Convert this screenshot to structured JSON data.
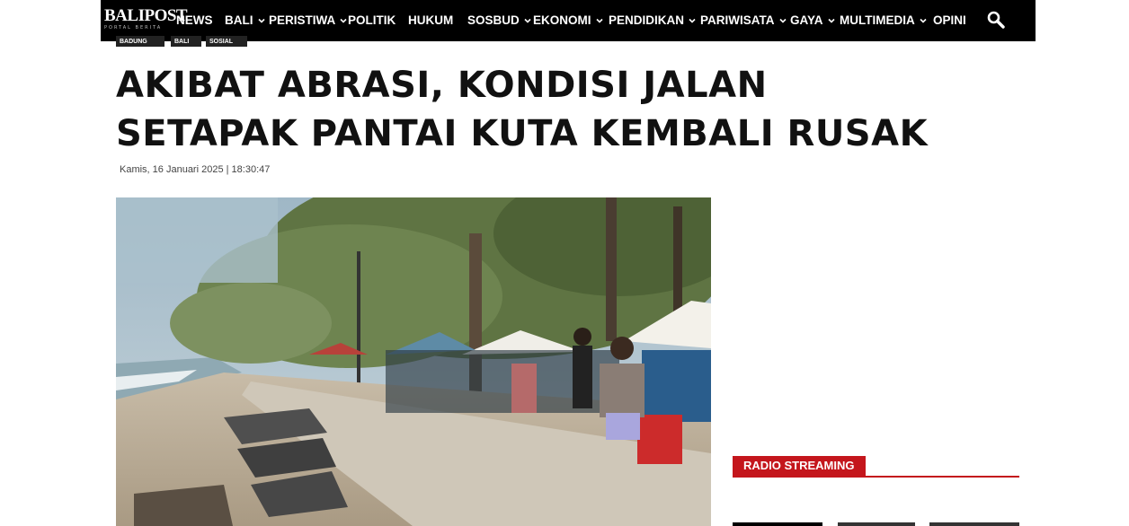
{
  "nav": {
    "logo_text": "BALIPOST",
    "logo_subtext": "PORTAL BERITA",
    "items": [
      {
        "label": "NEWS"
      },
      {
        "label": "BALI"
      },
      {
        "label": "PERISTIWA"
      },
      {
        "label": "POLITIK"
      },
      {
        "label": "HUKUM"
      },
      {
        "label": "SOSBUD"
      },
      {
        "label": "EKONOMI"
      },
      {
        "label": "PENDIDIKAN"
      },
      {
        "label": "PARIWISATA"
      },
      {
        "label": "GAYA"
      },
      {
        "label": "MULTIMEDIA"
      },
      {
        "label": "OPINI"
      }
    ],
    "search_icon": "search-icon"
  },
  "article": {
    "tags": [
      "BADUNG",
      "BALI",
      "SOSIAL"
    ],
    "title": "AKIBAT ABRASI, KONDISI JALAN SETAPAK PANTAI KUTA KEMBALI RUSAK",
    "date": "Kamis, 16 Januari 2025 | 18:30:47"
  },
  "sidebar": {
    "radio_label": "RADIO STREAMING"
  },
  "colors": {
    "nav_bg": "#000000",
    "accent": "#c4161c",
    "headline": "#111111"
  }
}
